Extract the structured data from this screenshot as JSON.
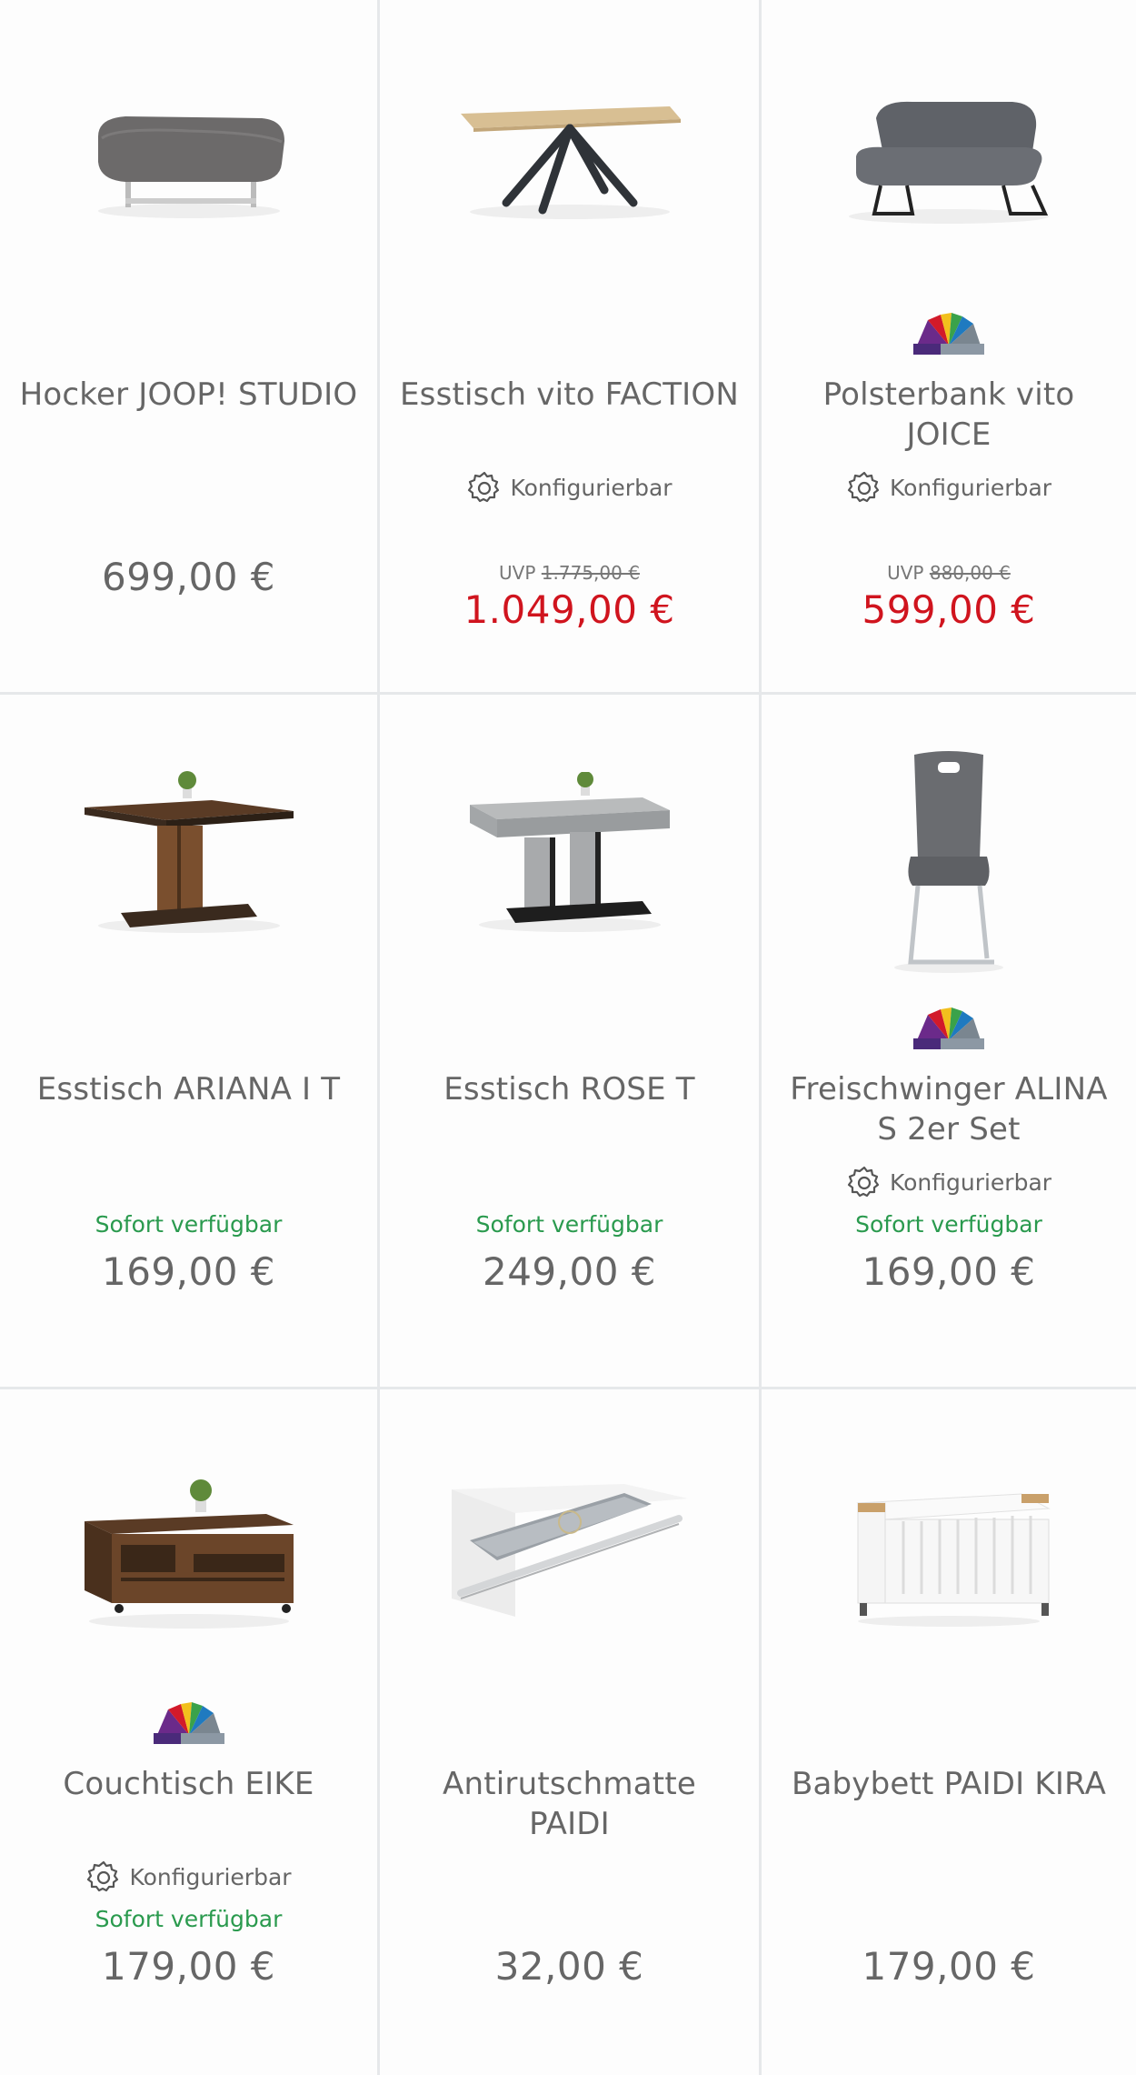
{
  "colors": {
    "text": "#666666",
    "sale_price": "#d0141e",
    "available": "#2a9a4e",
    "divider": "#e6e8ea"
  },
  "products": [
    {
      "title": "Hocker JOOP! STUDIO",
      "image_icon": "ottoman-image",
      "price": "699,00 €"
    },
    {
      "title": "Esstisch vito FACTION",
      "image_icon": "dining-table-image",
      "configurable": "Konfigurierbar",
      "uvp_label": "UVP",
      "uvp_price": "1.775,00 €",
      "price": "1.049,00 €"
    },
    {
      "title": "Polsterbank vito JOICE",
      "image_icon": "bench-image",
      "color_variants": "color-fan-icon",
      "configurable": "Konfigurierbar",
      "uvp_label": "UVP",
      "uvp_price": "880,00 €",
      "price": "599,00 €"
    },
    {
      "title": "Esstisch ARIANA I T",
      "image_icon": "wood-table-image",
      "availability": "Sofort verfügbar",
      "price": "169,00 €"
    },
    {
      "title": "Esstisch ROSE T",
      "image_icon": "concrete-table-image",
      "availability": "Sofort verfügbar",
      "price": "249,00 €"
    },
    {
      "title": "Freischwinger ALINA S 2er Set",
      "image_icon": "cantilever-chair-image",
      "color_variants": "color-fan-icon",
      "configurable": "Konfigurierbar",
      "availability": "Sofort verfügbar",
      "price": "169,00 €"
    },
    {
      "title": "Couchtisch EIKE",
      "image_icon": "coffee-table-image",
      "color_variants": "color-fan-icon",
      "configurable": "Konfigurierbar",
      "availability": "Sofort verfügbar",
      "price": "179,00 €"
    },
    {
      "title": "Antirutschmatte PAIDI",
      "image_icon": "anti-slip-mat-image",
      "price": "32,00 €"
    },
    {
      "title": "Babybett PAIDI KIRA",
      "image_icon": "baby-crib-image",
      "price": "179,00 €"
    }
  ]
}
